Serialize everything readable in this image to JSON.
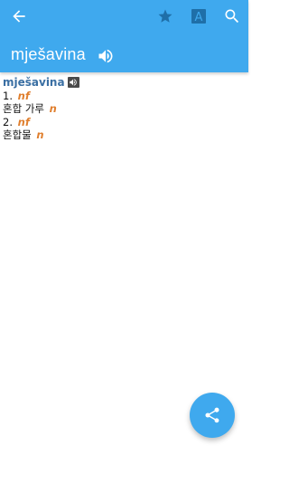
{
  "colors": {
    "appbar": "#3fa9ee",
    "entry_word": "#3a6fa3",
    "pos_tag": "#e07f2e",
    "fab": "#3fa9ee"
  },
  "toolbar": {
    "back_icon": "arrow-left-icon",
    "favorite_icon": "star-icon",
    "font_icon": "font-size-icon",
    "font_glyph": "A",
    "search_icon": "search-icon"
  },
  "header": {
    "headword": "mješavina",
    "speaker_icon": "volume-icon"
  },
  "entry": {
    "word": "mješavina",
    "senses": [
      {
        "number": "1.",
        "pos": "nf",
        "translation": "혼합 가루",
        "translation_pos": "n"
      },
      {
        "number": "2.",
        "pos": "nf",
        "translation": "혼합물",
        "translation_pos": "n"
      }
    ]
  },
  "fab": {
    "icon": "share-icon"
  }
}
